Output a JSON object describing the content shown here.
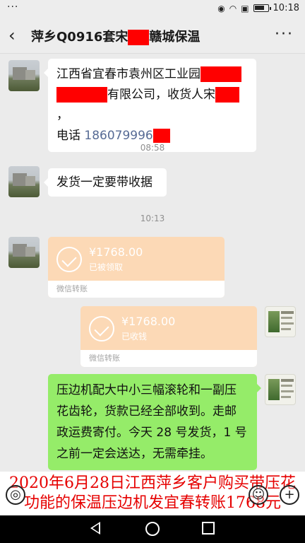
{
  "status_bar": {
    "dots": "···",
    "time": "10:18"
  },
  "header": {
    "back": "‹",
    "title_prefix": "萍乡Q0916套宋",
    "title_suffix": "赣城保温",
    "more": "···"
  },
  "messages": {
    "m1": {
      "line1": "江西省宜春市袁州区工业园",
      "line2": "有限公司，收货人宋",
      "line2_end": "，",
      "line3_label": "电话 ",
      "phone": "186079996"
    },
    "t1": "08:58",
    "m2": "发货一定要带收据",
    "t2": "10:13",
    "transfer1": {
      "amount": "¥1768.00",
      "status": "已被领取",
      "label": "微信转账"
    },
    "transfer2": {
      "amount": "¥1768.00",
      "status": "已收钱",
      "label": "微信转账"
    },
    "m3": {
      "line1": "压边机配大中小三幅滚轮和一副压",
      "line2": "花齿轮，货款已经全部收到。走邮",
      "line3": "政运费寄付。今天 28 号发货，1 号",
      "line4": "之前一定会送达，无需牵挂。"
    }
  },
  "caption": {
    "line1": "2020年6月28日江西萍乡客户购买带压花",
    "line2": "功能的保温压边机发宜春转账1768元"
  },
  "colors": {
    "redaction": "#ff0000",
    "transfer_bg": "#fcd9b6",
    "green_bubble": "#95ec69",
    "caption_red": "#e60000"
  }
}
